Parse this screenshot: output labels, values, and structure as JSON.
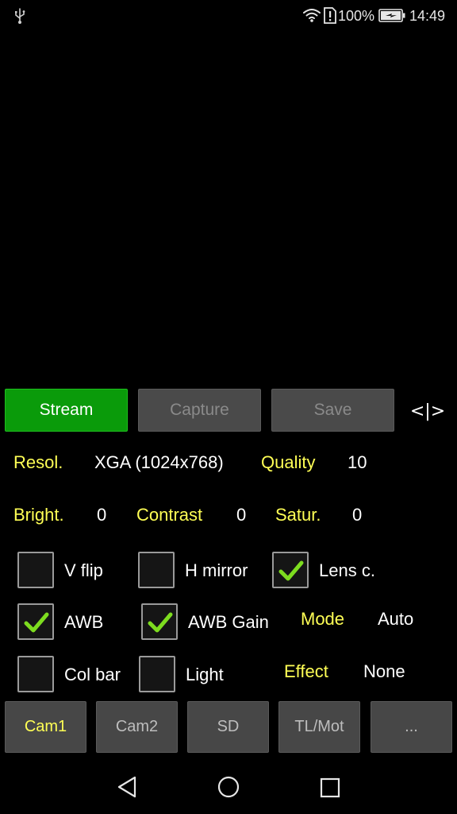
{
  "status_bar": {
    "battery_percent": "100%",
    "time": "14:49",
    "icons": [
      "usb-icon",
      "wifi-icon",
      "alert-icon",
      "battery-charging-icon"
    ]
  },
  "controls": {
    "stream_label": "Stream",
    "capture_label": "Capture",
    "save_label": "Save",
    "toggle_label": "<|>"
  },
  "settings": {
    "resolution_label": "Resol.",
    "resolution_value": "XGA (1024x768)",
    "quality_label": "Quality",
    "quality_value": "10",
    "brightness_label": "Bright.",
    "brightness_value": "0",
    "contrast_label": "Contrast",
    "contrast_value": "0",
    "saturation_label": "Satur.",
    "saturation_value": "0",
    "mode_label": "Mode",
    "mode_value": "Auto",
    "effect_label": "Effect",
    "effect_value": "None"
  },
  "checkboxes": {
    "vflip": {
      "label": "V flip",
      "checked": false
    },
    "hmirror": {
      "label": "H mirror",
      "checked": false
    },
    "lensc": {
      "label": "Lens c.",
      "checked": true
    },
    "awb": {
      "label": "AWB",
      "checked": true
    },
    "awbgain": {
      "label": "AWB Gain",
      "checked": true
    },
    "colbar": {
      "label": "Col bar",
      "checked": false
    },
    "light": {
      "label": "Light",
      "checked": false
    }
  },
  "tabs": [
    {
      "label": "Cam1",
      "active": true
    },
    {
      "label": "Cam2",
      "active": false
    },
    {
      "label": "SD",
      "active": false
    },
    {
      "label": "TL/Mot",
      "active": false
    },
    {
      "label": "...",
      "active": false
    }
  ],
  "colors": {
    "stream_green": "#0a9b0a",
    "label_yellow": "#ffff55",
    "check_green": "#7ddc1f",
    "button_gray": "#4a4a4a"
  }
}
